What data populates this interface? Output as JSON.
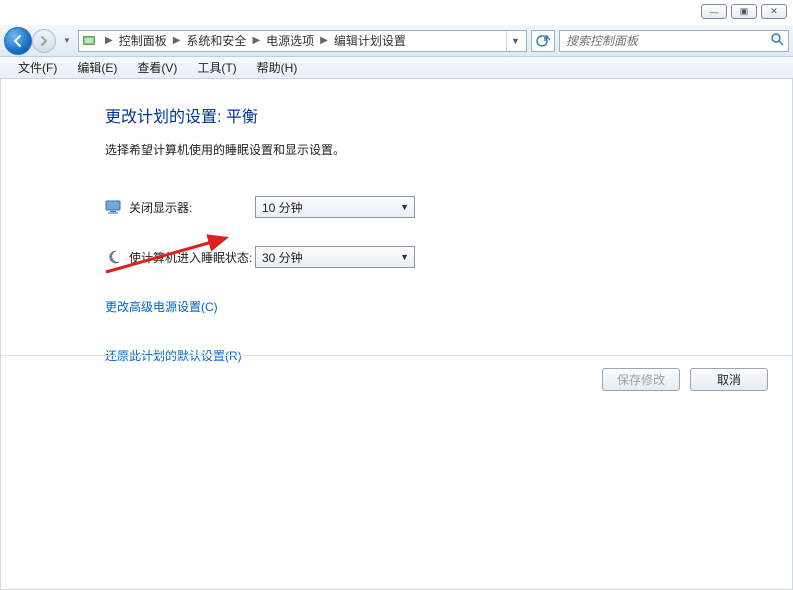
{
  "window_controls": {
    "minimize": "—",
    "maximize": "▣",
    "close": "✕"
  },
  "breadcrumb": {
    "items": [
      "控制面板",
      "系统和安全",
      "电源选项",
      "编辑计划设置"
    ]
  },
  "search": {
    "placeholder": "搜索控制面板"
  },
  "menu": {
    "file": "文件(F)",
    "edit": "编辑(E)",
    "view": "查看(V)",
    "tools": "工具(T)",
    "help": "帮助(H)"
  },
  "page": {
    "title": "更改计划的设置: 平衡",
    "desc": "选择希望计算机使用的睡眠设置和显示设置。"
  },
  "settings": {
    "display_off": {
      "label": "关闭显示器:",
      "value": "10 分钟"
    },
    "sleep": {
      "label": "使计算机进入睡眠状态:",
      "value": "30 分钟"
    }
  },
  "links": {
    "advanced": "更改高级电源设置(C)",
    "restore": "还原此计划的默认设置(R)"
  },
  "buttons": {
    "save": "保存修改",
    "cancel": "取消"
  }
}
